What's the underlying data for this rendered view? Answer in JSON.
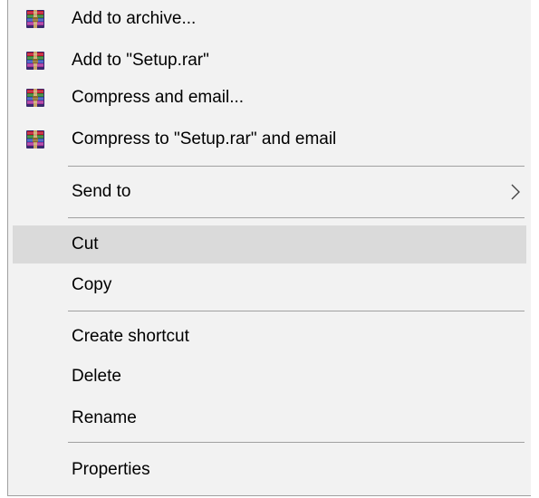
{
  "menu": {
    "items": [
      {
        "label": "Add to archive...",
        "icon": "winrar-archive-icon"
      },
      {
        "label": "Add to \"Setup.rar\"",
        "icon": "winrar-archive-icon"
      },
      {
        "label": "Compress and email...",
        "icon": "winrar-archive-icon"
      },
      {
        "label": "Compress to \"Setup.rar\" and email",
        "icon": "winrar-archive-icon"
      },
      {
        "label": "Send to",
        "icon": "chevron-right-icon"
      },
      {
        "label": "Cut",
        "state": "highlighted"
      },
      {
        "label": "Copy"
      },
      {
        "label": "Create shortcut"
      },
      {
        "label": "Delete"
      },
      {
        "label": "Rename"
      },
      {
        "label": "Properties"
      }
    ]
  },
  "colors": {
    "menu_background": "#f2f2f2",
    "highlight": "#dadada",
    "separator": "#a0a0a0",
    "text": "#000000"
  }
}
